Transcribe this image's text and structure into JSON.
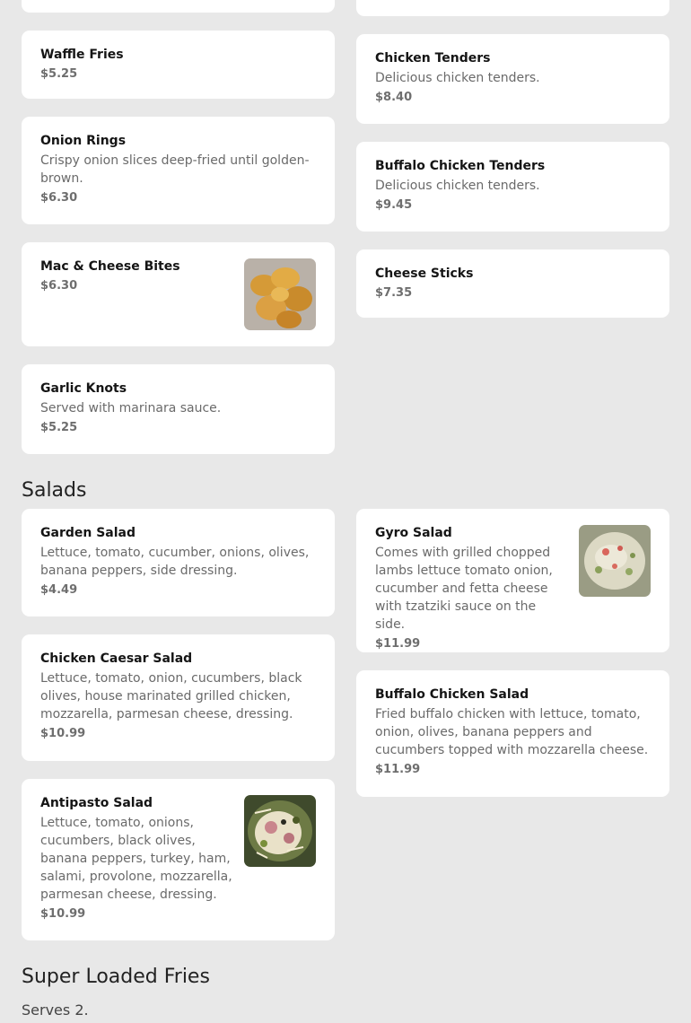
{
  "appetizers": {
    "left": [
      {
        "name": "Waffle Fries",
        "price": "$5.25"
      },
      {
        "name": "Onion Rings",
        "description": "Crispy onion slices deep-fried until golden-brown.",
        "price": "$6.30"
      },
      {
        "name": "Mac & Cheese Bites",
        "price": "$6.30",
        "image": "mac-and-cheese-bites-photo"
      },
      {
        "name": "Garlic Knots",
        "description": "Served with marinara sauce.",
        "price": "$5.25"
      }
    ],
    "right": [
      {
        "name": "Chicken Tenders",
        "description": "Delicious chicken tenders.",
        "price": "$8.40"
      },
      {
        "name": "Buffalo Chicken Tenders",
        "description": "Delicious chicken tenders.",
        "price": "$9.45"
      },
      {
        "name": "Cheese Sticks",
        "price": "$7.35"
      }
    ]
  },
  "salads": {
    "title": "Salads",
    "left": [
      {
        "name": "Garden Salad",
        "description": "Lettuce, tomato, cucumber, onions, olives, banana peppers, side dressing.",
        "price": "$4.49"
      },
      {
        "name": "Chicken Caesar Salad",
        "description": "Lettuce, tomato, onion, cucumbers, black olives, house marinated grilled chicken, mozzarella, parmesan cheese, dressing.",
        "price": "$10.99"
      },
      {
        "name": "Antipasto Salad",
        "description": "Lettuce, tomato, onions, cucumbers, black olives, banana peppers, turkey, ham, salami, provolone, mozzarella, parmesan cheese, dressing.",
        "price": "$10.99",
        "image": "antipasto-salad-photo"
      }
    ],
    "right": [
      {
        "name": "Gyro Salad",
        "description": "Comes with grilled chopped lambs lettuce tomato onion, cucumber and fetta cheese with tzatziki sauce on the side.",
        "price": "$11.99",
        "image": "gyro-salad-photo"
      },
      {
        "name": "Buffalo Chicken Salad",
        "description": "Fried buffalo chicken with lettuce, tomato, onion, olives, banana peppers and cucumbers topped with mozzarella cheese.",
        "price": "$11.99"
      }
    ]
  },
  "super_loaded_fries": {
    "title": "Super Loaded Fries",
    "note": "Serves 2."
  },
  "colors": {
    "background": "#e8e8e8",
    "card": "#ffffff",
    "price": "#6e6e6e"
  }
}
